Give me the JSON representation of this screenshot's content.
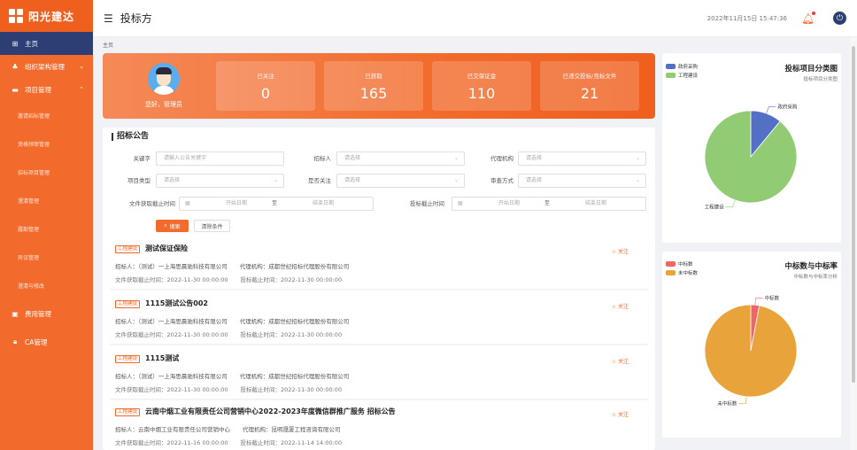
{
  "app": {
    "name": "阳光建达"
  },
  "sidebar": {
    "items": [
      {
        "label": "主页",
        "icon": "windows-icon",
        "active": true
      },
      {
        "label": "组织架构管理",
        "icon": "org-icon",
        "chevron": "down"
      },
      {
        "label": "项目管理",
        "icon": "folder-icon",
        "chevron": "up"
      }
    ],
    "sub_items": [
      "邀请招标管理",
      "资格预审管理",
      "招标项目管理",
      "澄清管理",
      "履勘管理",
      "异议管理",
      "澄清与修改"
    ],
    "bottom_items": [
      {
        "label": "费用管理",
        "icon": "wallet-icon"
      },
      {
        "label": "CA管理",
        "icon": "lock-icon"
      }
    ]
  },
  "header": {
    "title": "投标方",
    "datetime": "2022年11月15日 15:47:36"
  },
  "breadcrumb": "主页",
  "banner": {
    "greeting": "您好，管理员",
    "stats": [
      {
        "label": "已关注",
        "value": "0"
      },
      {
        "label": "已获取",
        "value": "165"
      },
      {
        "label": "已交保证金",
        "value": "110"
      },
      {
        "label": "已递交投标/竞标文件",
        "value": "21"
      }
    ]
  },
  "announcements": {
    "title": "招标公告",
    "filters": {
      "keyword": {
        "label": "关键字",
        "placeholder": "请输入公告关键字"
      },
      "tenderer": {
        "label": "招标人",
        "placeholder": "请选择"
      },
      "agency": {
        "label": "代理机构",
        "placeholder": "请选择"
      },
      "project_type": {
        "label": "项目类型",
        "placeholder": "请选择"
      },
      "followed": {
        "label": "是否关注",
        "placeholder": "请选择"
      },
      "review_method": {
        "label": "审查方式",
        "placeholder": "请选择"
      },
      "doc_deadline": {
        "label": "文件获取截止时间",
        "start": "开始日期",
        "to": "至",
        "end": "结束日期"
      },
      "bid_deadline": {
        "label": "投标截止时间",
        "start": "开始日期",
        "to": "至",
        "end": "结束日期"
      }
    },
    "search_label": "搜索",
    "clear_label": "清除条件",
    "follow_label": "关注",
    "items": [
      {
        "tag": "工程建设",
        "title": "测试保证保险",
        "tenderer": "招标人：（测试）一上海思晨驰科技有限公司",
        "agency": "代理机构：成都世纪招标代理股份有限公司",
        "doc_deadline": "文件获取截止时间：2022-11-30 00:00:00",
        "bid_deadline": "投标截止时间：2022-11-30 00:00:00"
      },
      {
        "tag": "工程建设",
        "title": "1115测试公告002",
        "tenderer": "招标人：（测试）一上海思晨驰科技有限公司",
        "agency": "代理机构：成都世纪招标代理股份有限公司",
        "doc_deadline": "文件获取截止时间：2022-11-30 00:00:00",
        "bid_deadline": "投标截止时间：2022-11-30 00:00:00"
      },
      {
        "tag": "工程建设",
        "title": "1115测试",
        "tenderer": "招标人：（测试）一上海思晨驰科技有限公司",
        "agency": "代理机构：成都世纪招标代理股份有限公司",
        "doc_deadline": "文件获取截止时间：2022-11-30 00:00:00",
        "bid_deadline": "投标截止时间：2022-11-30 00:00:00"
      },
      {
        "tag": "工程建设",
        "title": "云南中烟工业有限责任公司营销中心2022-2023年度微信群推广服务 招标公告",
        "tenderer": "招标人：云南中烟工业有限责任公司营销中心",
        "agency": "代理机构：昆明晟厦工程咨询有限公司",
        "doc_deadline": "文件获取截止时间：2022-11-16 00:00:00",
        "bid_deadline": "投标截止时间：2022-11-14 14:00:00"
      }
    ]
  },
  "chart_data": [
    {
      "type": "pie",
      "title": "投标项目分类图",
      "subtitle": "投标项目分类图",
      "categories": [
        "政府采购",
        "工程建设"
      ],
      "values": [
        11,
        89
      ],
      "colors": [
        "#5470c6",
        "#91cc75"
      ],
      "legend": "top-left"
    },
    {
      "type": "pie",
      "title": "中标数与中标率",
      "subtitle": "中标数与中标率分析",
      "categories": [
        "中标数",
        "未中标数"
      ],
      "values": [
        3,
        97
      ],
      "colors": [
        "#ee6666",
        "#e8a33a"
      ],
      "legend": "top-left"
    }
  ],
  "colors": {
    "brand": "#f26b2c",
    "active_menu": "#2c3e73"
  }
}
